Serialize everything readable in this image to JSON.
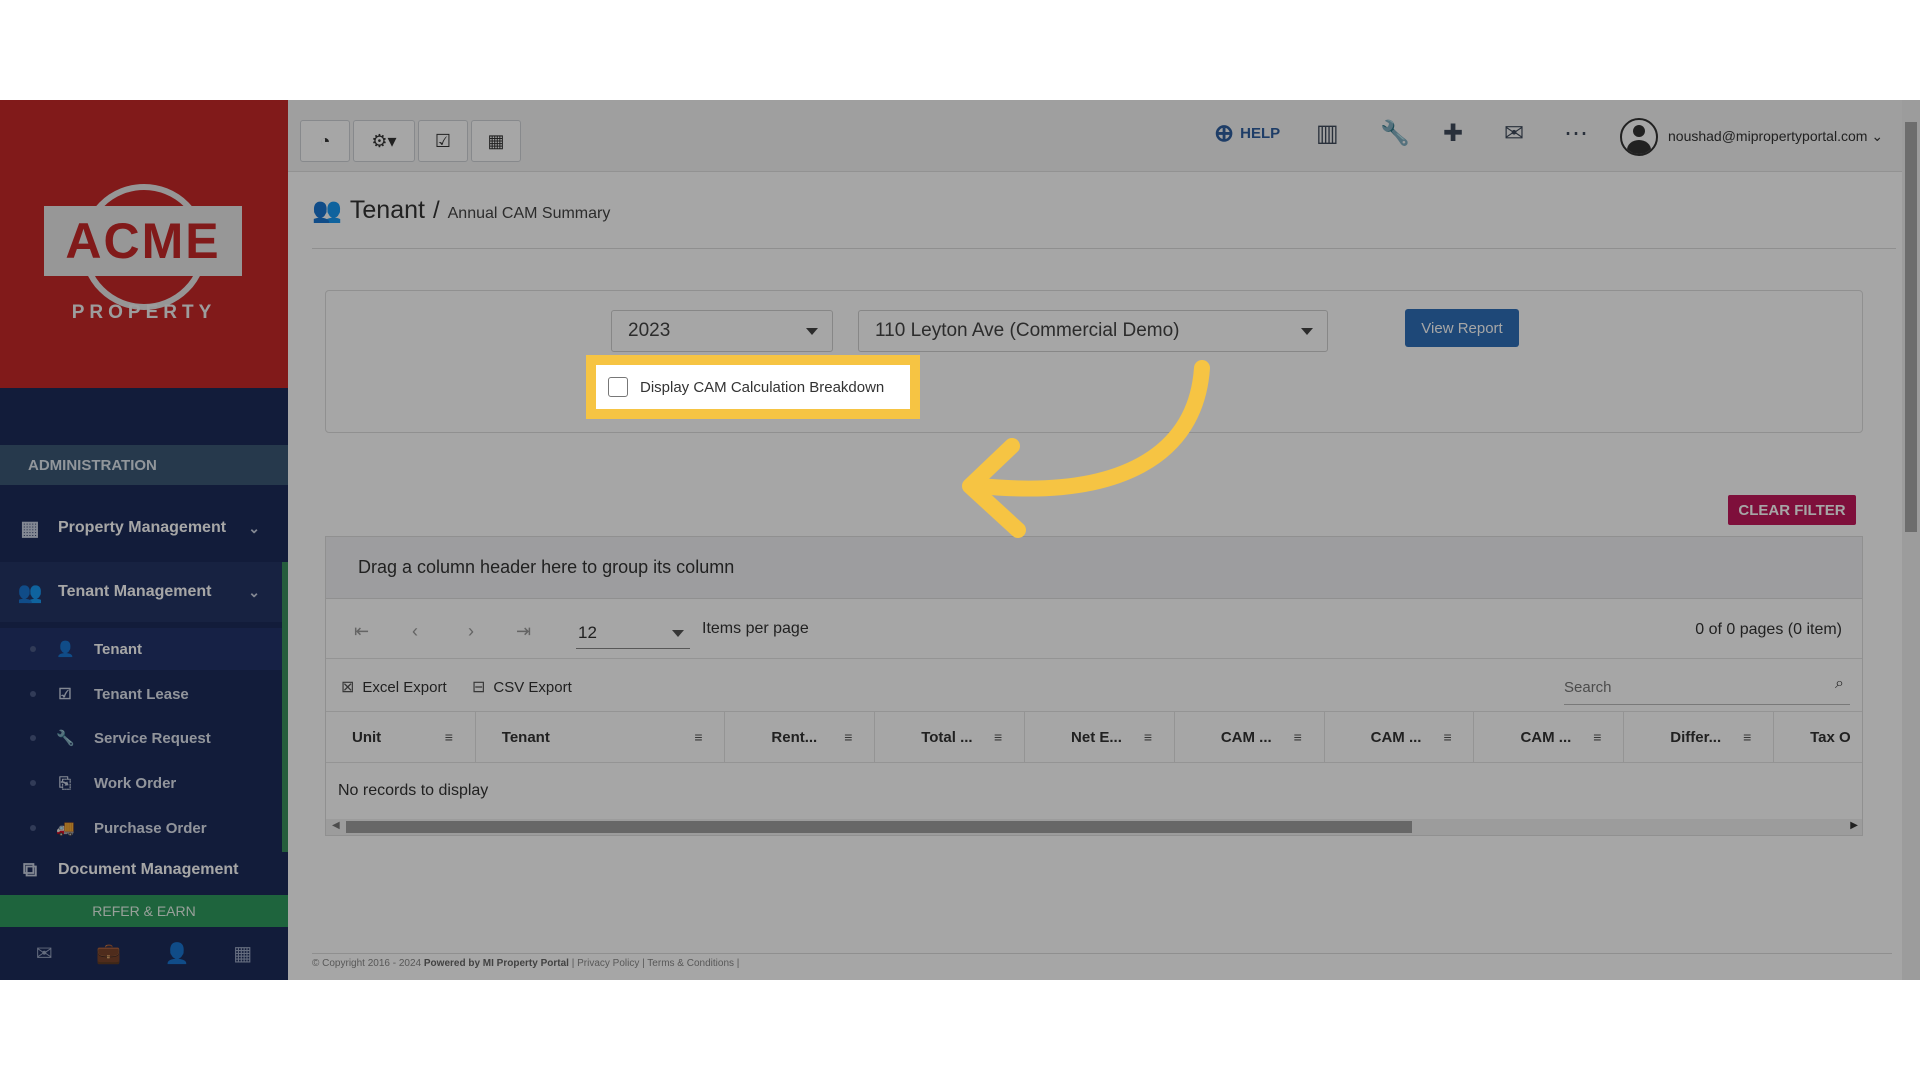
{
  "sidebar": {
    "logo_text": "ACME",
    "logo_sub": "PROPERTY",
    "section_label": "ADMINISTRATION",
    "parents": [
      {
        "label": "Property Management",
        "icon": "building-icon"
      },
      {
        "label": "Tenant Management",
        "icon": "users-icon"
      },
      {
        "label": "Document Management",
        "icon": "documents-icon"
      }
    ],
    "sub_items": [
      {
        "label": "Tenant",
        "icon": "user-icon"
      },
      {
        "label": "Tenant Lease",
        "icon": "calendar-check-icon"
      },
      {
        "label": "Service Request",
        "icon": "wrench-icon"
      },
      {
        "label": "Work Order",
        "icon": "copy-icon"
      },
      {
        "label": "Purchase Order",
        "icon": "truck-icon"
      }
    ],
    "refer_label": "REFER & EARN",
    "bottom_icons": [
      "mail-icon",
      "briefcase-icon",
      "user-icon",
      "calculator-icon"
    ]
  },
  "topbar": {
    "left_buttons": [
      "dashboard-icon",
      "gear-icon",
      "calendar-check-icon",
      "calculator-icon"
    ],
    "help_label": "HELP",
    "right_icons": [
      "bar-chart-icon",
      "wrench-icon",
      "plus-icon",
      "mail-icon",
      "more-icon"
    ],
    "user_email": "noushad@mipropertyportal.com"
  },
  "page": {
    "title": "Tenant",
    "separator": "/",
    "subtitle": "Annual CAM Summary"
  },
  "filters": {
    "year": "2023",
    "property": "110 Leyton Ave (Commercial Demo)",
    "view_report_label": "View Report",
    "cam_checkbox_label": "Display CAM Calculation Breakdown",
    "cam_checked": false
  },
  "grid": {
    "clear_filter_label": "CLEAR FILTER",
    "group_hint": "Drag a column header here to group its column",
    "page_size": "12",
    "items_per_page_label": "Items per page",
    "page_info": "0 of 0 pages (0 item)",
    "excel_label": "Excel Export",
    "csv_label": "CSV Export",
    "search_placeholder": "Search",
    "columns": [
      "Unit",
      "Tenant",
      "Rent...",
      "Total ...",
      "Net E...",
      "CAM ...",
      "CAM ...",
      "CAM ...",
      "Differ...",
      "Tax O"
    ],
    "empty_text": "No records to display"
  },
  "footer": {
    "copyright": "© Copyright 2016 - 2024",
    "powered": "Powered by MI Property Portal",
    "links": "| Privacy Policy | Terms & Conditions |"
  },
  "colors": {
    "sidebar": "#1c2b5a",
    "logo_bg": "#c62828",
    "highlight": "#f6c443",
    "primary": "#2e6fb8",
    "clear_filter": "#c2185b",
    "refer": "#2e9a5e"
  }
}
